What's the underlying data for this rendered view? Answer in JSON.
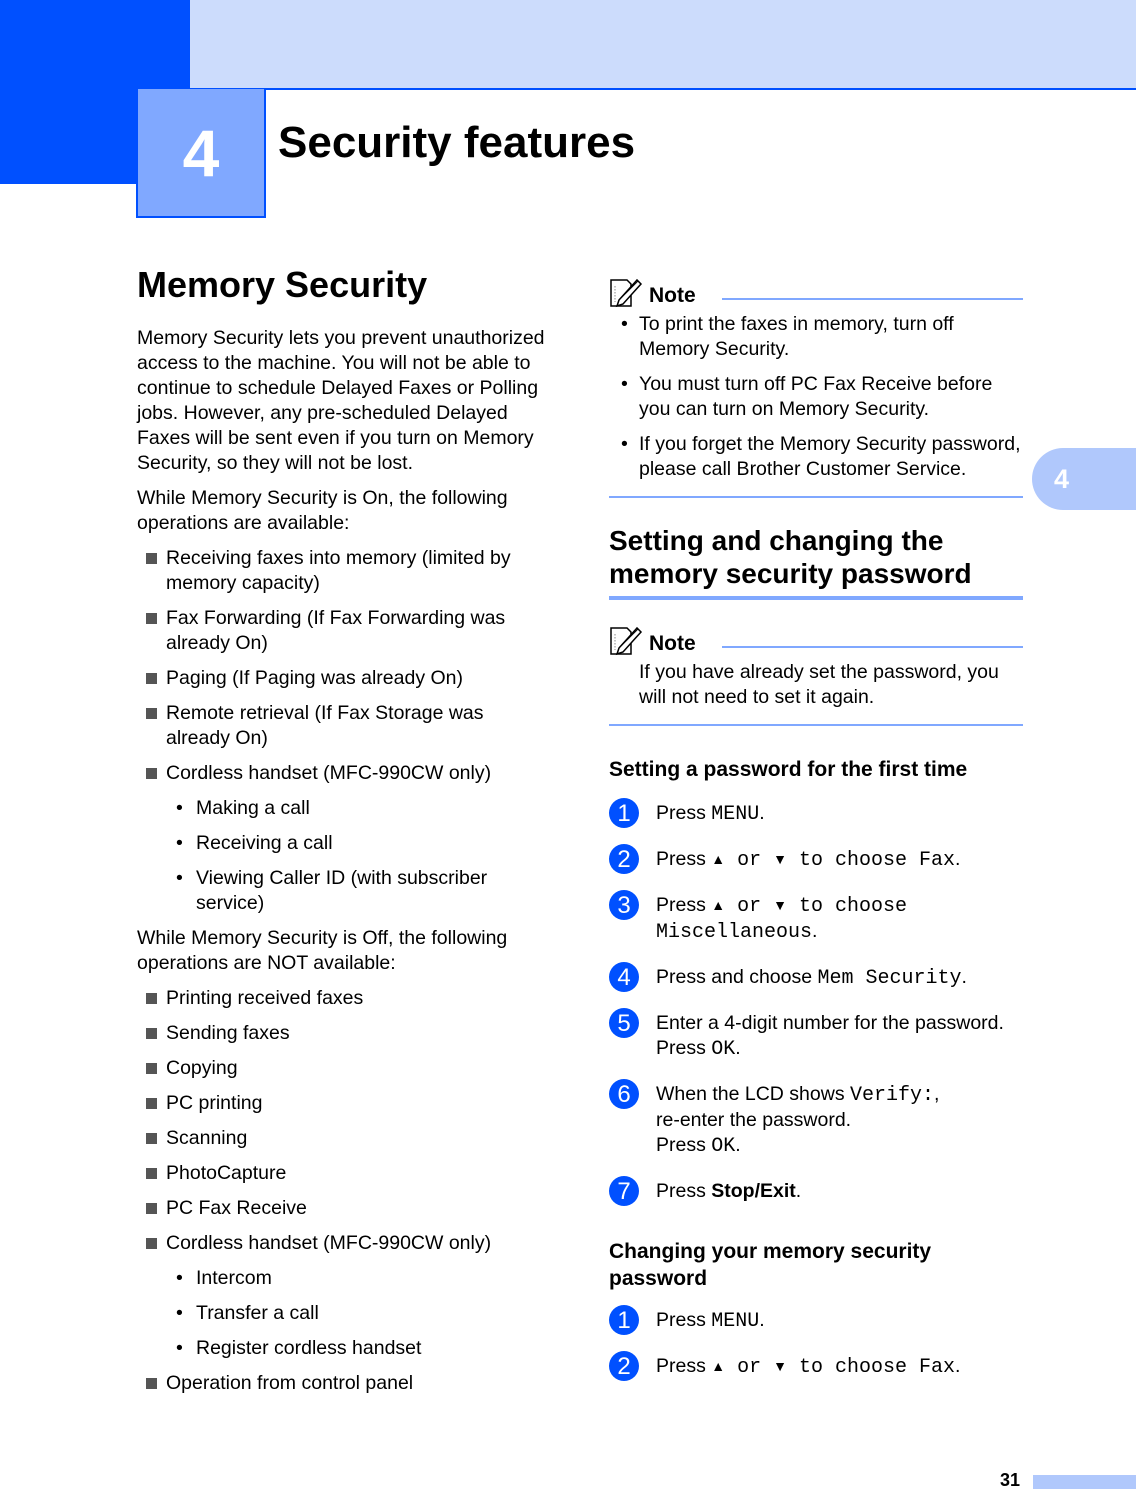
{
  "header": {
    "chapter_number": "4",
    "chapter_title": "Security features",
    "side_tab": "4",
    "colors": {
      "primary": "#0050ff",
      "light": "#ccdcfc",
      "accent": "#80a8ff",
      "tab": "#b0c8fc"
    }
  },
  "left": {
    "section_title": "Memory Security",
    "intro": "Memory Security lets you prevent unauthorized access to the machine. You will not be able to continue to schedule Delayed Faxes or Polling jobs. However, any pre-scheduled Delayed Faxes will be sent even if you turn on Memory Security, so they will not be lost.",
    "on_heading": "While Memory Security is On, the following operations are available:",
    "on_items": [
      {
        "text": "Receiving faxes into memory (limited by memory capacity)"
      },
      {
        "text": "Fax Forwarding (If Fax Forwarding was already On)"
      },
      {
        "text": "Paging (If Paging was already On)"
      },
      {
        "text": "Remote retrieval (If Fax Storage was already On)"
      },
      {
        "text": "Cordless handset (MFC-990CW only)"
      }
    ],
    "on_subitems": [
      "Making a call",
      "Receiving a call",
      "Viewing Caller ID (with subscriber service)"
    ],
    "off_heading": "While Memory Security is Off, the following operations are NOT available:",
    "off_items": [
      "Printing received faxes",
      "Sending faxes",
      "Copying",
      "PC printing",
      "Scanning",
      "PhotoCapture",
      "PC Fax Receive",
      "Cordless handset (MFC-990CW only)"
    ],
    "off_subitems": [
      "Intercom",
      "Transfer a call",
      "Register cordless handset"
    ],
    "off_last_item": "Operation from control panel"
  },
  "right": {
    "note1": {
      "label": "Note",
      "items": [
        "To print the faxes in memory, turn off Memory Security.",
        "You must turn off PC Fax Receive before you can turn on Memory Security.",
        "If you forget the Memory Security password, please call Brother Customer Service."
      ]
    },
    "section_title": "Setting and changing the memory security password",
    "note2": {
      "label": "Note",
      "text": "If you have already set the password, you will not need to set it again."
    },
    "first_time": {
      "title": "Setting a password for the first time",
      "steps": [
        {
          "num": "1",
          "pre": "Press ",
          "code": "MENU",
          "post": "."
        },
        {
          "num": "2",
          "pre": "Press ",
          "code_after_arrows": " to choose Fax",
          "post": "."
        },
        {
          "num": "3",
          "pre": "Press ",
          "code_after_arrows": " to choose",
          "code2": "Miscellaneous",
          "post": "."
        },
        {
          "num": "4",
          "pre": "Press and choose ",
          "code": "Mem Security",
          "post": "."
        },
        {
          "num": "5",
          "line1": "Enter a 4-digit number for the password.",
          "pre": "Press ",
          "code": "OK",
          "post": "."
        },
        {
          "num": "6",
          "pre": "When the LCD shows ",
          "code": "Verify:",
          "post": ",",
          "line2": "re-enter the password.",
          "line3pre": "Press ",
          "line3code": "OK",
          "line3post": "."
        },
        {
          "num": "7",
          "pre": "Press ",
          "bold": "Stop/Exit",
          "post": "."
        }
      ]
    },
    "change": {
      "title": "Changing your memory security password",
      "steps": [
        {
          "num": "1",
          "pre": "Press ",
          "code": "MENU",
          "post": "."
        },
        {
          "num": "2",
          "pre": "Press ",
          "code_after_arrows": " to choose Fax",
          "post": "."
        }
      ]
    },
    "arrows": {
      "up": "▲",
      "or": " or ",
      "down": "▼"
    }
  },
  "footer": {
    "page_number": "31"
  }
}
